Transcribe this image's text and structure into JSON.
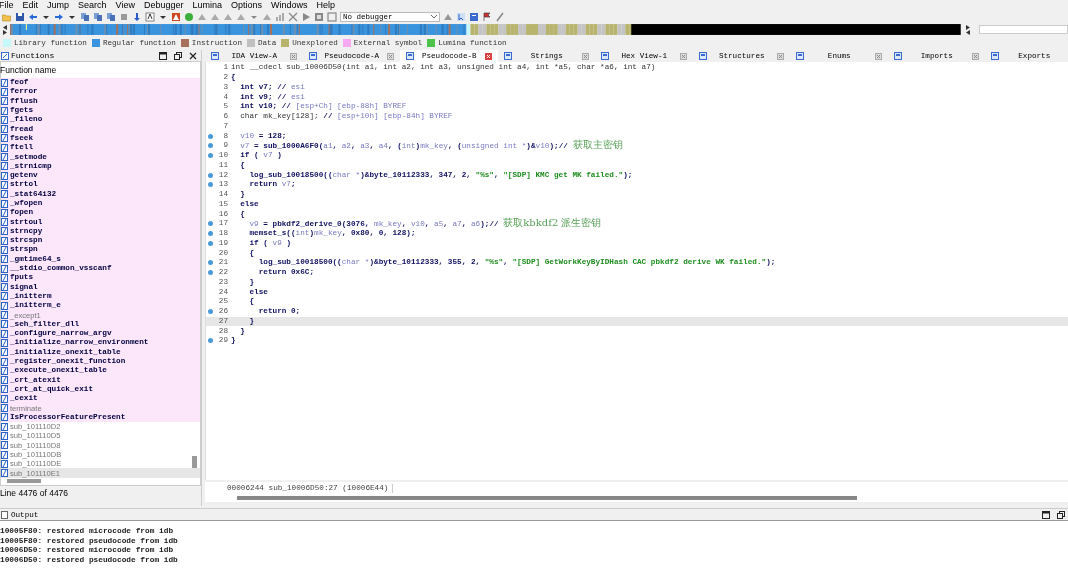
{
  "menu_bar": [
    "File",
    "Edit",
    "Jump",
    "Search",
    "View",
    "Debugger",
    "Lumina",
    "Options",
    "Windows",
    "Help"
  ],
  "toolbar": {
    "debugger_select": "No debugger"
  },
  "legend": [
    {
      "label": "Library function",
      "color": "#c6f7f9"
    },
    {
      "label": "Regular function",
      "color": "#3a94dd"
    },
    {
      "label": "Instruction",
      "color": "#a6705a"
    },
    {
      "label": "Data",
      "color": "#c0c0c0"
    },
    {
      "label": "Unexplored",
      "color": "#b8b46e"
    },
    {
      "label": "External symbol",
      "color": "#f6a8f2"
    },
    {
      "label": "Lumina function",
      "color": "#4cc44c"
    }
  ],
  "functions_panel": {
    "title": "Functions",
    "column": "Function name",
    "status": "Line 4476 of 4476",
    "items": [
      {
        "name": "feof",
        "kind": "library",
        "selected": false
      },
      {
        "name": "ferror",
        "kind": "library",
        "selected": false
      },
      {
        "name": "fflush",
        "kind": "library",
        "selected": false
      },
      {
        "name": "fgets",
        "kind": "library",
        "selected": false
      },
      {
        "name": "_fileno",
        "kind": "library",
        "selected": false
      },
      {
        "name": "fread",
        "kind": "library",
        "selected": false
      },
      {
        "name": "fseek",
        "kind": "library",
        "selected": false
      },
      {
        "name": "ftell",
        "kind": "library",
        "selected": false
      },
      {
        "name": "_setmode",
        "kind": "library",
        "selected": false
      },
      {
        "name": "_strnicmp",
        "kind": "library",
        "selected": false
      },
      {
        "name": "getenv",
        "kind": "library",
        "selected": false
      },
      {
        "name": "strtol",
        "kind": "library",
        "selected": false
      },
      {
        "name": "_stat64i32",
        "kind": "library",
        "selected": false
      },
      {
        "name": "_wfopen",
        "kind": "library",
        "selected": false
      },
      {
        "name": "fopen",
        "kind": "library",
        "selected": false
      },
      {
        "name": "strtoul",
        "kind": "library",
        "selected": false
      },
      {
        "name": "strncpy",
        "kind": "library",
        "selected": false
      },
      {
        "name": "strcspn",
        "kind": "library",
        "selected": false
      },
      {
        "name": "strspn",
        "kind": "library",
        "selected": false
      },
      {
        "name": "_gmtime64_s",
        "kind": "library",
        "selected": false
      },
      {
        "name": "__stdio_common_vsscanf",
        "kind": "library",
        "selected": false
      },
      {
        "name": "fputs",
        "kind": "library",
        "selected": false
      },
      {
        "name": "signal",
        "kind": "library",
        "selected": false
      },
      {
        "name": "_initterm",
        "kind": "library",
        "selected": false
      },
      {
        "name": "_initterm_e",
        "kind": "library",
        "selected": false
      },
      {
        "name": "_except1",
        "kind": "library-thunk",
        "selected": false
      },
      {
        "name": "_seh_filter_dll",
        "kind": "library",
        "selected": false
      },
      {
        "name": "_configure_narrow_argv",
        "kind": "library",
        "selected": false
      },
      {
        "name": "_initialize_narrow_environment",
        "kind": "library",
        "selected": false
      },
      {
        "name": "_initialize_onexit_table",
        "kind": "library",
        "selected": false
      },
      {
        "name": "_register_onexit_function",
        "kind": "library",
        "selected": false
      },
      {
        "name": "_execute_onexit_table",
        "kind": "library",
        "selected": false
      },
      {
        "name": "_crt_atexit",
        "kind": "library",
        "selected": false
      },
      {
        "name": "_crt_at_quick_exit",
        "kind": "library",
        "selected": false
      },
      {
        "name": "_cexit",
        "kind": "library",
        "selected": false
      },
      {
        "name": "terminate",
        "kind": "library-thunk",
        "selected": false
      },
      {
        "name": "IsProcessorFeaturePresent",
        "kind": "library",
        "selected": false
      },
      {
        "name": "sub_101110D2",
        "kind": "regular",
        "selected": false
      },
      {
        "name": "sub_101110D5",
        "kind": "regular",
        "selected": false
      },
      {
        "name": "sub_101110D8",
        "kind": "regular",
        "selected": false
      },
      {
        "name": "sub_101110DB",
        "kind": "regular",
        "selected": false
      },
      {
        "name": "sub_101110DE",
        "kind": "regular",
        "selected": false
      },
      {
        "name": "sub_101110E1",
        "kind": "regular",
        "selected": true
      }
    ]
  },
  "tabs": [
    {
      "label": "IDA View-A",
      "selected": false
    },
    {
      "label": "Pseudocode-A",
      "selected": false
    },
    {
      "label": "Pseudocode-B",
      "selected": true
    },
    {
      "label": "Strings",
      "selected": false
    },
    {
      "label": "Hex View-1",
      "selected": false
    },
    {
      "label": "Structures",
      "selected": false
    },
    {
      "label": "Enums",
      "selected": false
    },
    {
      "label": "Imports",
      "selected": false
    },
    {
      "label": "Exports",
      "selected": false
    }
  ],
  "pseudocode": {
    "status": "00006244 sub_10006D50:27 (10006E44)",
    "lines": [
      {
        "number": "1",
        "breakpoint": false,
        "current": false,
        "tokens": [
          {
            "kind": "plain",
            "text": "int __cdecl sub_10006D50(int a1, int a2, int a3, unsigned int a4, int *a5, char *a6, int a7)"
          }
        ]
      },
      {
        "number": "2",
        "breakpoint": false,
        "current": false,
        "tokens": [
          {
            "kind": "code",
            "text": "{"
          }
        ]
      },
      {
        "number": "3",
        "breakpoint": false,
        "current": false,
        "tokens": [
          {
            "kind": "code",
            "text": "  int v7; // "
          },
          {
            "kind": "var",
            "text": "esi"
          }
        ]
      },
      {
        "number": "4",
        "breakpoint": false,
        "current": false,
        "tokens": [
          {
            "kind": "code",
            "text": "  int v9; // "
          },
          {
            "kind": "var",
            "text": "esi"
          }
        ]
      },
      {
        "number": "5",
        "breakpoint": false,
        "current": false,
        "tokens": [
          {
            "kind": "code",
            "text": "  int v10; // "
          },
          {
            "kind": "var",
            "text": "[esp+Ch] [ebp-88h] BYREF"
          }
        ]
      },
      {
        "number": "6",
        "breakpoint": false,
        "current": false,
        "tokens": [
          {
            "kind": "plain",
            "text": "  char mk_key[128]; "
          },
          {
            "kind": "code",
            "text": "// "
          },
          {
            "kind": "var",
            "text": "[esp+10h] [ebp-84h] BYREF"
          }
        ]
      },
      {
        "number": "7",
        "breakpoint": false,
        "current": false
      },
      {
        "number": "8",
        "breakpoint": true,
        "current": false,
        "tokens": [
          {
            "kind": "var",
            "text": "  v10"
          },
          {
            "kind": "code",
            "text": " = 128;"
          }
        ]
      },
      {
        "number": "9",
        "breakpoint": true,
        "current": false,
        "tokens": [
          {
            "kind": "var",
            "text": "  v7"
          },
          {
            "kind": "code",
            "text": " = sub_1000A6F0("
          },
          {
            "kind": "var",
            "text": "a1"
          },
          {
            "kind": "code",
            "text": ", "
          },
          {
            "kind": "var",
            "text": "a2"
          },
          {
            "kind": "code",
            "text": ", "
          },
          {
            "kind": "var",
            "text": "a3"
          },
          {
            "kind": "code",
            "text": ", "
          },
          {
            "kind": "var",
            "text": "a4"
          },
          {
            "kind": "code",
            "text": ", ("
          },
          {
            "kind": "var",
            "text": "int"
          },
          {
            "kind": "code",
            "text": ")"
          },
          {
            "kind": "var",
            "text": "mk_key"
          },
          {
            "kind": "code",
            "text": ", ("
          },
          {
            "kind": "var",
            "text": "unsigned int *"
          },
          {
            "kind": "code",
            "text": ")&"
          },
          {
            "kind": "var",
            "text": "v10"
          },
          {
            "kind": "code",
            "text": ");// "
          },
          {
            "kind": "note",
            "text": "获取主密钥"
          }
        ]
      },
      {
        "number": "10",
        "breakpoint": true,
        "current": false,
        "tokens": [
          {
            "kind": "code",
            "text": "  if ( "
          },
          {
            "kind": "var",
            "text": "v7"
          },
          {
            "kind": "code",
            "text": " )"
          }
        ]
      },
      {
        "number": "11",
        "breakpoint": false,
        "current": false,
        "tokens": [
          {
            "kind": "code",
            "text": "  {"
          }
        ]
      },
      {
        "number": "12",
        "breakpoint": true,
        "current": false,
        "tokens": [
          {
            "kind": "code",
            "text": "    log_sub_10018500(("
          },
          {
            "kind": "var",
            "text": "char *"
          },
          {
            "kind": "code",
            "text": ")&byte_10112333, 347, 2, "
          },
          {
            "kind": "string",
            "text": "\"%s\""
          },
          {
            "kind": "code",
            "text": ", "
          },
          {
            "kind": "string",
            "text": "\"[SDP] KMC get MK failed.\""
          },
          {
            "kind": "code",
            "text": ");"
          }
        ]
      },
      {
        "number": "13",
        "breakpoint": true,
        "current": false,
        "tokens": [
          {
            "kind": "code",
            "text": "    return "
          },
          {
            "kind": "var",
            "text": "v7"
          },
          {
            "kind": "code",
            "text": ";"
          }
        ]
      },
      {
        "number": "14",
        "breakpoint": false,
        "current": false,
        "tokens": [
          {
            "kind": "code",
            "text": "  }"
          }
        ]
      },
      {
        "number": "15",
        "breakpoint": false,
        "current": false,
        "tokens": [
          {
            "kind": "code",
            "text": "  else"
          }
        ]
      },
      {
        "number": "16",
        "breakpoint": false,
        "current": false,
        "tokens": [
          {
            "kind": "code",
            "text": "  {"
          }
        ]
      },
      {
        "number": "17",
        "breakpoint": true,
        "current": false,
        "tokens": [
          {
            "kind": "var",
            "text": "    v9"
          },
          {
            "kind": "code",
            "text": " = pbkdf2_derive_0(3076, "
          },
          {
            "kind": "var",
            "text": "mk_key"
          },
          {
            "kind": "code",
            "text": ", "
          },
          {
            "kind": "var",
            "text": "v10"
          },
          {
            "kind": "code",
            "text": ", "
          },
          {
            "kind": "var",
            "text": "a5"
          },
          {
            "kind": "code",
            "text": ", "
          },
          {
            "kind": "var",
            "text": "a7"
          },
          {
            "kind": "code",
            "text": ", "
          },
          {
            "kind": "var",
            "text": "a6"
          },
          {
            "kind": "code",
            "text": ");// "
          },
          {
            "kind": "note",
            "text": "获取kbkdf2 派生密钥"
          }
        ]
      },
      {
        "number": "18",
        "breakpoint": true,
        "current": false,
        "tokens": [
          {
            "kind": "code",
            "text": "    memset_s(("
          },
          {
            "kind": "var",
            "text": "int"
          },
          {
            "kind": "code",
            "text": ")"
          },
          {
            "kind": "var",
            "text": "mk_key"
          },
          {
            "kind": "code",
            "text": ", 0x80, 0, 128);"
          }
        ]
      },
      {
        "number": "19",
        "breakpoint": true,
        "current": false,
        "tokens": [
          {
            "kind": "code",
            "text": "    if ( "
          },
          {
            "kind": "var",
            "text": "v9"
          },
          {
            "kind": "code",
            "text": " )"
          }
        ]
      },
      {
        "number": "20",
        "breakpoint": false,
        "current": false,
        "tokens": [
          {
            "kind": "code",
            "text": "    {"
          }
        ]
      },
      {
        "number": "21",
        "breakpoint": true,
        "current": false,
        "tokens": [
          {
            "kind": "code",
            "text": "      log_sub_10018500(("
          },
          {
            "kind": "var",
            "text": "char *"
          },
          {
            "kind": "code",
            "text": ")&byte_10112333, 355, 2, "
          },
          {
            "kind": "string",
            "text": "\"%s\""
          },
          {
            "kind": "code",
            "text": ", "
          },
          {
            "kind": "string",
            "text": "\"[SDP] GetWorkKeyByIDHash CAC pbkdf2 derive WK failed.\""
          },
          {
            "kind": "code",
            "text": ");"
          }
        ]
      },
      {
        "number": "22",
        "breakpoint": true,
        "current": false,
        "tokens": [
          {
            "kind": "code",
            "text": "      return 0x6C;"
          }
        ]
      },
      {
        "number": "23",
        "breakpoint": false,
        "current": false,
        "tokens": [
          {
            "kind": "code",
            "text": "    }"
          }
        ]
      },
      {
        "number": "24",
        "breakpoint": false,
        "current": false,
        "tokens": [
          {
            "kind": "code",
            "text": "    else"
          }
        ]
      },
      {
        "number": "25",
        "breakpoint": false,
        "current": false,
        "tokens": [
          {
            "kind": "code",
            "text": "    {"
          }
        ]
      },
      {
        "number": "26",
        "breakpoint": true,
        "current": false,
        "tokens": [
          {
            "kind": "code",
            "text": "      return 0;"
          }
        ]
      },
      {
        "number": "27",
        "breakpoint": false,
        "current": true,
        "tokens": [
          {
            "kind": "code",
            "text": "    }"
          }
        ]
      },
      {
        "number": "28",
        "breakpoint": false,
        "current": false,
        "tokens": [
          {
            "kind": "code",
            "text": "  }"
          }
        ]
      },
      {
        "number": "29",
        "breakpoint": true,
        "current": false,
        "tokens": [
          {
            "kind": "code",
            "text": "}"
          }
        ]
      }
    ]
  },
  "output": {
    "title": "Output",
    "lines": [
      "10005F80: restored microcode from idb",
      "10005F80: restored pseudocode from idb",
      "10006D50: restored microcode from idb",
      "10006D50: restored pseudocode from idb"
    ]
  }
}
